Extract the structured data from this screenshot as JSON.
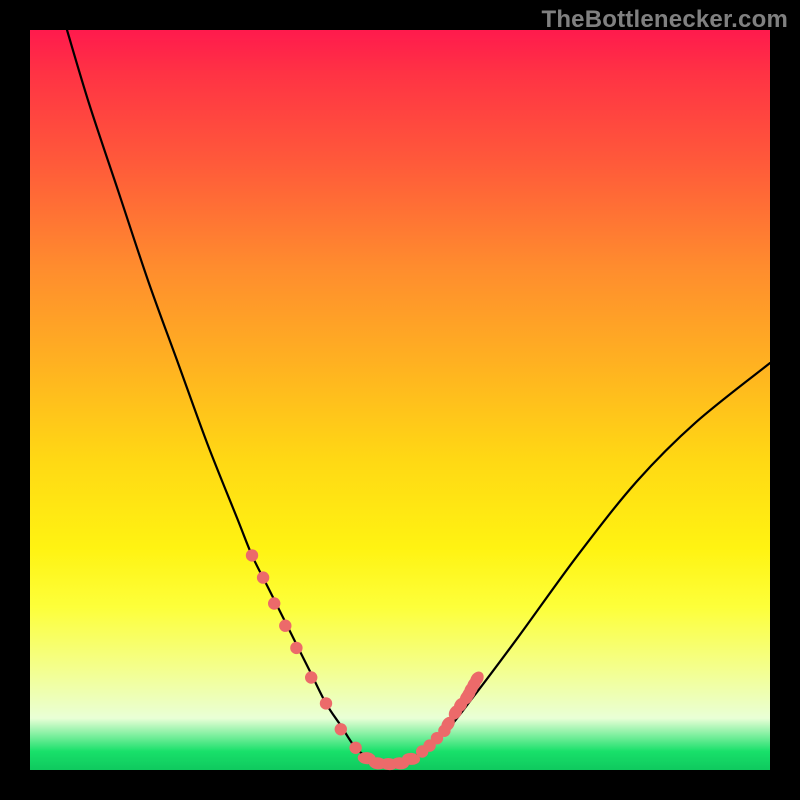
{
  "watermark": "TheBottlenecker.com",
  "colors": {
    "frame": "#000000",
    "gradient_top": "#ff1a4d",
    "gradient_bottom": "#0fc95e",
    "curve": "#000000",
    "marker": "#ec6a6a"
  },
  "chart_data": {
    "type": "line",
    "title": "",
    "xlabel": "",
    "ylabel": "",
    "xlim": [
      0,
      100
    ],
    "ylim": [
      0,
      100
    ],
    "curve": {
      "x": [
        5,
        8,
        12,
        16,
        20,
        24,
        28,
        30,
        32,
        34,
        36,
        38,
        40,
        42,
        44,
        46,
        48,
        50,
        52,
        56,
        60,
        66,
        74,
        82,
        90,
        100
      ],
      "y": [
        100,
        90,
        78,
        66,
        55,
        44,
        34,
        29,
        25,
        21,
        17,
        13,
        9,
        6,
        3,
        1.5,
        0.8,
        0.8,
        1.8,
        5,
        10,
        18,
        29,
        39,
        47,
        55
      ]
    },
    "markers": [
      {
        "x": 30.0,
        "y": 29.0
      },
      {
        "x": 31.5,
        "y": 26.0
      },
      {
        "x": 33.0,
        "y": 22.5
      },
      {
        "x": 34.5,
        "y": 19.5
      },
      {
        "x": 36.0,
        "y": 16.5
      },
      {
        "x": 38.0,
        "y": 12.5
      },
      {
        "x": 40.0,
        "y": 9.0
      },
      {
        "x": 42.0,
        "y": 5.5
      },
      {
        "x": 44.0,
        "y": 3.0
      },
      {
        "x": 45.5,
        "y": 1.6
      },
      {
        "x": 47.0,
        "y": 0.9
      },
      {
        "x": 48.5,
        "y": 0.8
      },
      {
        "x": 50.0,
        "y": 0.9
      },
      {
        "x": 51.5,
        "y": 1.5
      },
      {
        "x": 53.0,
        "y": 2.5
      },
      {
        "x": 54.0,
        "y": 3.3
      },
      {
        "x": 55.0,
        "y": 4.3
      },
      {
        "x": 56.0,
        "y": 5.3
      },
      {
        "x": 56.5,
        "y": 6.2
      },
      {
        "x": 57.5,
        "y": 7.8
      },
      {
        "x": 58.2,
        "y": 8.8
      },
      {
        "x": 59.0,
        "y": 9.8
      },
      {
        "x": 59.3,
        "y": 10.3
      },
      {
        "x": 59.6,
        "y": 10.9
      },
      {
        "x": 60.0,
        "y": 11.6
      },
      {
        "x": 60.4,
        "y": 12.3
      }
    ]
  }
}
